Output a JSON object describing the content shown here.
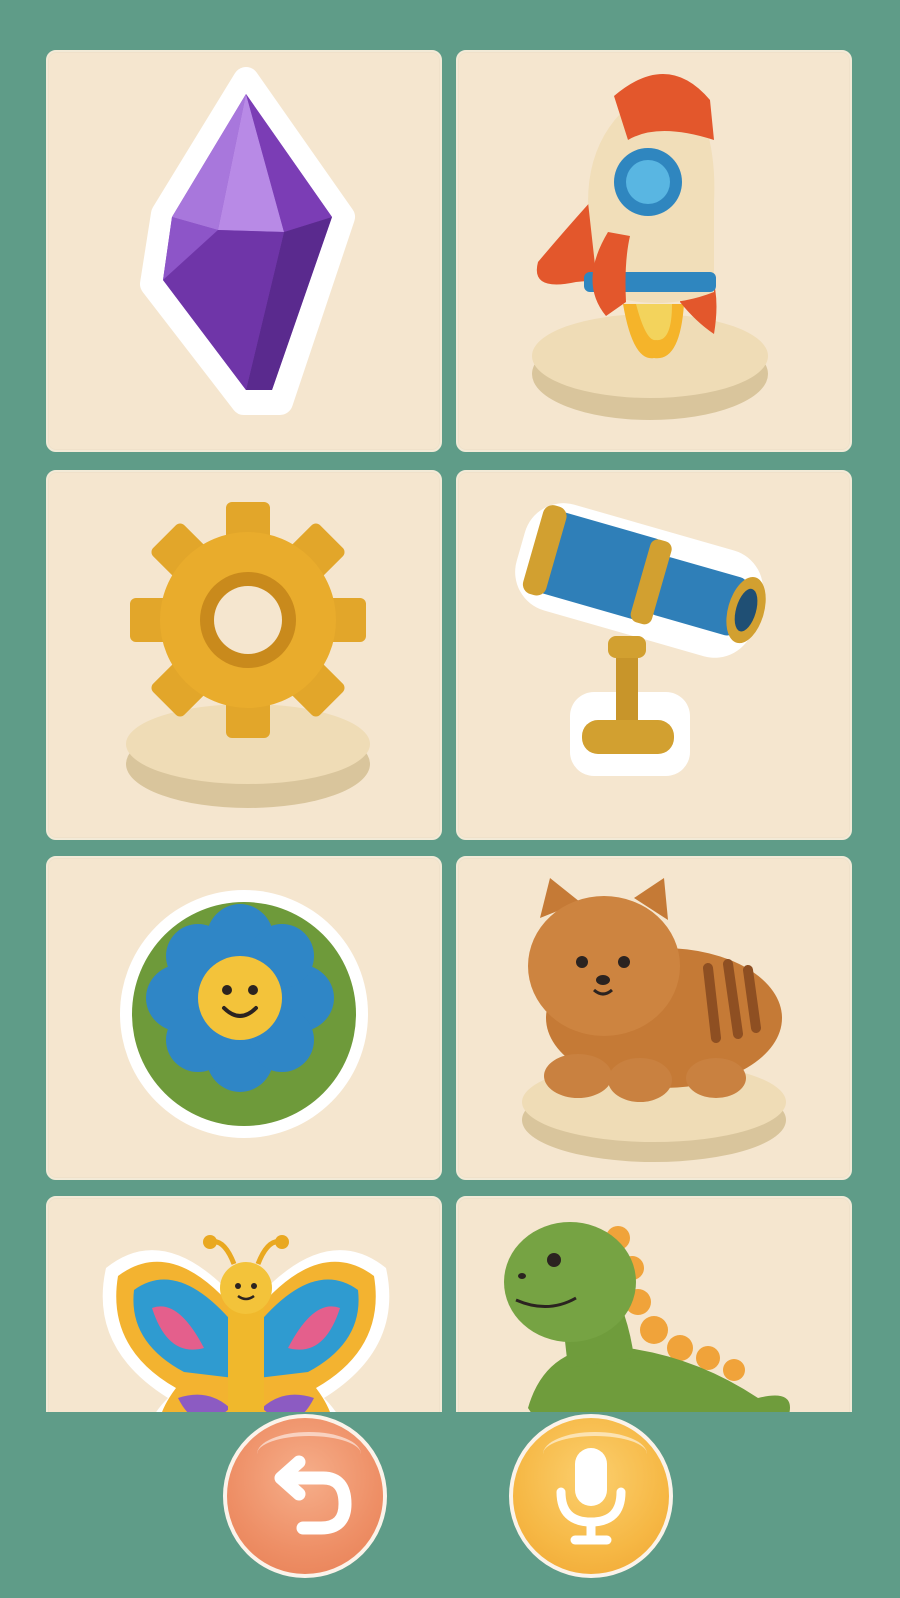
{
  "screen": {
    "background_color": "#5f9c88",
    "card_color": "#f5e6cf"
  },
  "items": [
    {
      "name": "crystal",
      "icon": "purple-crystal-sticker"
    },
    {
      "name": "rocket",
      "icon": "rocket-on-pedestal"
    },
    {
      "name": "gear",
      "icon": "yellow-gear-on-pedestal"
    },
    {
      "name": "telescope",
      "icon": "blue-telescope-sticker"
    },
    {
      "name": "flower",
      "icon": "smiling-flower-badge"
    },
    {
      "name": "cat",
      "icon": "orange-cat-on-pedestal"
    },
    {
      "name": "butterfly",
      "icon": "butterfly-sticker"
    },
    {
      "name": "dinosaur",
      "icon": "green-dinosaur-figure"
    }
  ],
  "controls": {
    "undo_icon": "undo-arrow-icon",
    "undo_color": "#ee8f66",
    "mic_icon": "microphone-icon",
    "mic_color": "#f6b845"
  }
}
